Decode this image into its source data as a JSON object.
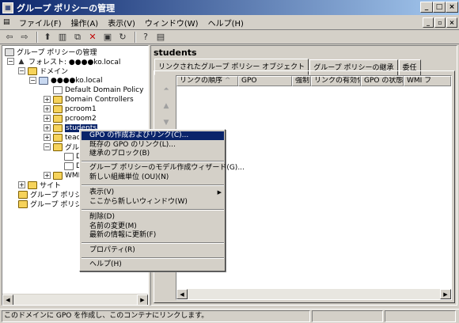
{
  "window": {
    "title": "グループ ポリシーの管理"
  },
  "menu": [
    "ファイル(F)",
    "操作(A)",
    "表示(V)",
    "ウィンドウ(W)",
    "ヘルプ(H)"
  ],
  "tree": {
    "root": "グループ ポリシーの管理",
    "forest": "フォレスト: ●●●●ko.local",
    "domains": "ドメイン",
    "domain": "●●●●ko.local",
    "children": [
      "Default Domain Policy",
      "Domain Controllers",
      "pcroom1",
      "pcroom2",
      "students",
      "teach",
      "グルー",
      "D",
      "D",
      "WMI"
    ],
    "sites": "サイト",
    "gp1": "グループ ポリシー",
    "gp2": "グループ ポリシー"
  },
  "right": {
    "title": "students",
    "tabs": [
      "リンクされたグループ ポリシー オブジェクト",
      "グループ ポリシーの継承",
      "委任"
    ],
    "columns": [
      "リンクの順序",
      "GPO",
      "強制",
      "リンクの有効化",
      "GPO の状態",
      "WMI フ"
    ]
  },
  "context_menu": {
    "items": [
      "GPO の作成およびリンク(C)...",
      "既存の GPO のリンク(L)...",
      "継承のブロック(B)",
      "グループ ポリシーのモデル作成ウィザード(G)...",
      "新しい組織単位 (OU)(N)",
      "表示(V)",
      "ここから新しいウィンドウ(W)",
      "削除(D)",
      "名前の変更(M)",
      "最新の情報に更新(F)",
      "プロパティ(R)",
      "ヘルプ(H)"
    ]
  },
  "status": {
    "text": "このドメインに GPO を作成し、このコンテナにリンクします。"
  }
}
